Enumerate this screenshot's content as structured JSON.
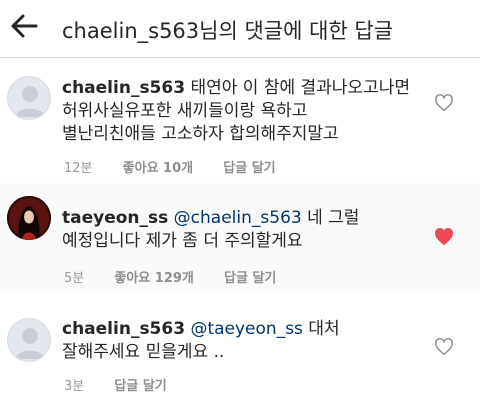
{
  "header": {
    "title": "chaelin_s563님의 댓글에 대한 답글"
  },
  "comments": [
    {
      "username": "chaelin_s563",
      "mention": "",
      "lines": [
        "태연아 이 참에 결과나오고나면",
        "허위사실유포한 새끼들이랑 욕하고",
        "별난리친애들 고소하자 합의해주지말고"
      ],
      "time": "12분",
      "likes": "좋아요 10개",
      "reply": "답글 달기",
      "liked": false
    },
    {
      "username": "taeyeon_ss",
      "mention": "@chaelin_s563",
      "lines": [
        "네 그럴",
        "예정입니다 제가 좀 더 주의할게요"
      ],
      "time": "5분",
      "likes": "좋아요 129개",
      "reply": "답글 달기",
      "liked": true
    },
    {
      "username": "chaelin_s563",
      "mention": "@taeyeon_ss",
      "lines": [
        "대처",
        "잘해주세요 믿을게요 .."
      ],
      "time": "3분",
      "likes": "",
      "reply": "답글 달기",
      "liked": false
    }
  ],
  "colors": {
    "like_red": "#ed4956",
    "mention_blue": "#003569",
    "meta_gray": "#999999"
  },
  "icons": {
    "back": "arrow-left-icon",
    "like": "heart-outline-icon",
    "liked": "heart-filled-icon"
  }
}
